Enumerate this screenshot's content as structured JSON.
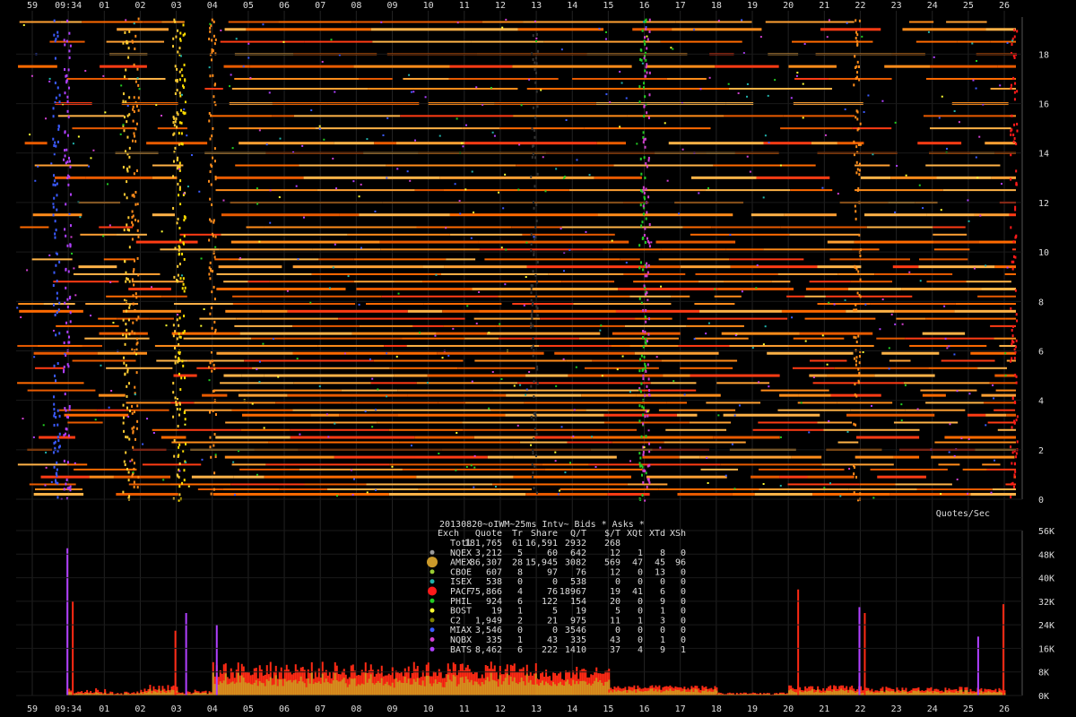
{
  "chart_data": [
    {
      "type": "scatter",
      "title": "",
      "x_ticks": [
        "59",
        "09:34",
        "01",
        "02",
        "03",
        "04",
        "05",
        "06",
        "07",
        "08",
        "09",
        "10",
        "11",
        "12",
        "13",
        "14",
        "15",
        "16",
        "17",
        "18",
        "19",
        "20",
        "21",
        "22",
        "23",
        "24",
        "25",
        "26"
      ],
      "y_ticks": [
        "0",
        "2",
        "4",
        "6",
        "8",
        "10",
        "12",
        "14",
        "16",
        "18"
      ],
      "ylim": [
        0,
        19.5
      ],
      "grid": true,
      "levels": [
        0.2,
        0.4,
        0.6,
        0.9,
        1.2,
        1.4,
        1.7,
        2.0,
        2.3,
        2.5,
        2.8,
        3.1,
        3.4,
        3.6,
        3.9,
        4.2,
        4.4,
        4.7,
        5.0,
        5.3,
        5.6,
        5.9,
        6.2,
        6.5,
        6.7,
        7.0,
        7.3,
        7.6,
        7.9,
        8.2,
        8.5,
        8.8,
        9.1,
        9.4,
        9.7,
        10.1,
        10.4,
        10.7,
        11.0,
        11.5,
        12.0,
        12.5,
        13.0,
        13.5,
        14.0,
        14.4,
        15.0,
        15.5,
        16.0,
        16.6,
        17.0,
        17.5,
        18.0,
        18.5,
        19.0,
        19.3
      ]
    },
    {
      "type": "bar",
      "ylabel": "Quotes/Sec",
      "y_ticks": [
        "0K",
        "8K",
        "16K",
        "24K",
        "32K",
        "40K",
        "48K",
        "56K"
      ],
      "ylim": [
        0,
        56000
      ],
      "grid": true,
      "segments": [
        {
          "from": "09:34",
          "to": "01",
          "base": 600,
          "peak": 2500
        },
        {
          "from": "01",
          "to": "02",
          "base": 400,
          "peak": 1500
        },
        {
          "from": "02",
          "to": "03",
          "base": 1200,
          "peak": 4000
        },
        {
          "from": "03",
          "to": "04",
          "base": 500,
          "peak": 2000
        },
        {
          "from": "04",
          "to": "13",
          "base": 5500,
          "peak": 11500
        },
        {
          "from": "13",
          "to": "14",
          "base": 5000,
          "peak": 9000
        },
        {
          "from": "14",
          "to": "15",
          "base": 5500,
          "peak": 10000
        },
        {
          "from": "15",
          "to": "18",
          "base": 1800,
          "peak": 3500
        },
        {
          "from": "18",
          "to": "19",
          "base": 300,
          "peak": 1200
        },
        {
          "from": "19",
          "to": "20",
          "base": 300,
          "peak": 1000
        },
        {
          "from": "20",
          "to": "22",
          "base": 1500,
          "peak": 3500
        },
        {
          "from": "22",
          "to": "26",
          "base": 1200,
          "peak": 3000
        }
      ],
      "spikes": [
        {
          "at": "09:34",
          "value": 50000
        },
        {
          "at": "09:34",
          "value": 32000
        },
        {
          "at": "03",
          "value": 28000
        },
        {
          "at": "03",
          "value": 22000
        },
        {
          "at": "04",
          "value": 24000
        },
        {
          "at": "20",
          "value": 36000
        },
        {
          "at": "22",
          "value": 30000
        },
        {
          "at": "22",
          "value": 28000
        },
        {
          "at": "25",
          "value": 20000
        },
        {
          "at": "26",
          "value": 31000
        }
      ],
      "stats": {
        "caption": "20130820~oIWM~25ms Intv~ Bids * Asks *",
        "columns": [
          "Exch",
          "Quote",
          "Tr",
          "Share",
          "Q/T",
          "$/T",
          "XQt",
          "XTd",
          "XSh"
        ],
        "rows": [
          {
            "name": "Totl",
            "marker": "",
            "values": [
              "181,765",
              "61",
              "16,591",
              "2932",
              "268",
              "",
              "",
              ""
            ]
          },
          {
            "name": "NQEX",
            "marker": "#9a9a9a",
            "values": [
              "3,212",
              "5",
              "60",
              "642",
              "12",
              "1",
              "8",
              "0"
            ]
          },
          {
            "name": "AMEX",
            "marker": "#cc9a2a",
            "values": [
              "86,307",
              "28",
              "15,945",
              "3082",
              "569",
              "47",
              "45",
              "96"
            ]
          },
          {
            "name": "CBOE",
            "marker": "#9acd32",
            "values": [
              "607",
              "8",
              "97",
              "76",
              "12",
              "0",
              "13",
              "0"
            ]
          },
          {
            "name": "ISEX",
            "marker": "#20b2aa",
            "values": [
              "538",
              "0",
              "0",
              "538",
              "0",
              "0",
              "0",
              "0"
            ]
          },
          {
            "name": "PACF",
            "marker": "#ff1a1a",
            "values": [
              "75,866",
              "4",
              "76",
              "18967",
              "19",
              "41",
              "6",
              "0"
            ]
          },
          {
            "name": "PHIL",
            "marker": "#22cc22",
            "values": [
              "924",
              "6",
              "122",
              "154",
              "20",
              "0",
              "9",
              "0"
            ]
          },
          {
            "name": "BOST",
            "marker": "#ffff33",
            "values": [
              "19",
              "1",
              "5",
              "19",
              "5",
              "0",
              "1",
              "0"
            ]
          },
          {
            "name": "C2",
            "marker": "#808000",
            "values": [
              "1,949",
              "2",
              "21",
              "975",
              "11",
              "1",
              "3",
              "0"
            ]
          },
          {
            "name": "MIAX",
            "marker": "#3b5bff",
            "values": [
              "3,546",
              "0",
              "0",
              "3546",
              "0",
              "0",
              "0",
              "0"
            ]
          },
          {
            "name": "NQBX",
            "marker": "#d040d0",
            "values": [
              "335",
              "1",
              "43",
              "335",
              "43",
              "0",
              "1",
              "0"
            ]
          },
          {
            "name": "BATS",
            "marker": "#b040ff",
            "values": [
              "8,462",
              "6",
              "222",
              "1410",
              "37",
              "4",
              "9",
              "1"
            ]
          }
        ]
      }
    }
  ]
}
